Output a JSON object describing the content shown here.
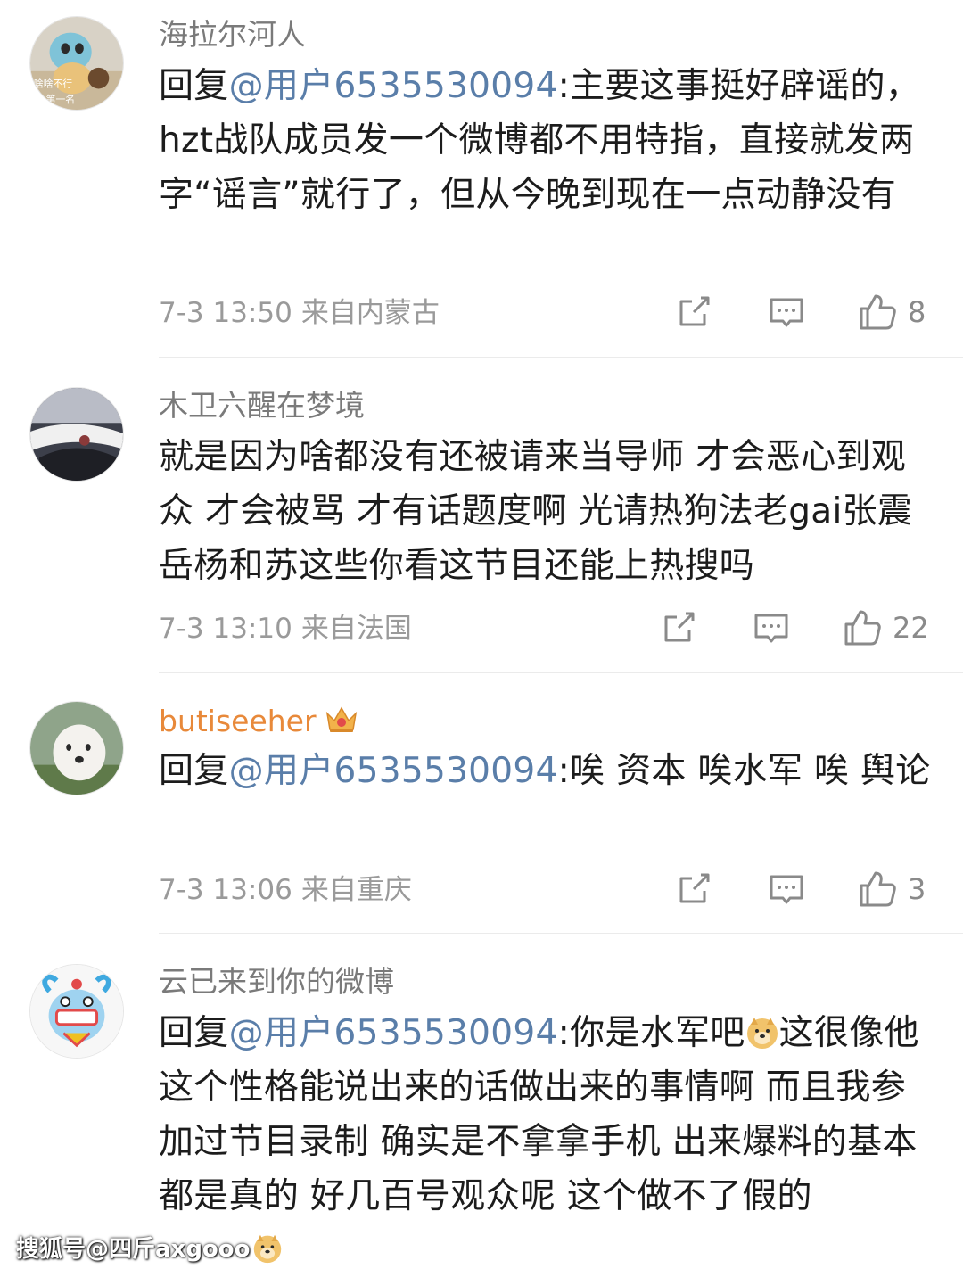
{
  "comments": [
    {
      "username": "海拉尔河人",
      "reply_prefix": "回复",
      "mention": "@用户6535530094",
      "text": ":主要这事挺好辟谣的，hzt战队成员发一个微博都不用特指，直接就发两字“谣言”就行了，但从今晚到现在一点动静没有",
      "time": "7-3 13:50",
      "source": "来自内蒙古",
      "likes": "8",
      "avatar_caption": "啥啥不行 第一名"
    },
    {
      "username": "木卫六醒在梦境",
      "text": "就是因为啥都没有还被请来当导师 才会恶心到观众 才会被骂 才有话题度啊 光请热狗法老gai张震岳杨和苏这些你看这节目还能上热搜吗",
      "time": "7-3 13:10",
      "source": "来自法国",
      "likes": "22"
    },
    {
      "username": "butiseeher",
      "reply_prefix": "回复",
      "mention": "@用户6535530094",
      "text": ":唉 资本 唉水军 唉 舆论",
      "time": "7-3 13:06",
      "source": "来自重庆",
      "likes": "3"
    },
    {
      "username": "云已来到你的微博",
      "reply_prefix": "回复",
      "mention": "@用户6535530094",
      "text_a": ":你是水军吧",
      "text_b": "这很像他这个性格能说出来的话做出来的事情啊 而且我参加过节目录制 确实是不拿拿手机 出来爆料的基本都是真的 好几百号观众呢 这个做不了假的"
    }
  ],
  "icons": {
    "share": "share-icon",
    "comment": "comment-icon",
    "like": "thumbs-up-icon",
    "vip": "crown-badge-icon",
    "emoji": "doge-emoji-icon"
  },
  "colors": {
    "mention": "#5a7ea9",
    "vip_name": "#e8893a",
    "meta": "#9a9a9a"
  },
  "watermark": "搜狐号@四斤axgooo"
}
